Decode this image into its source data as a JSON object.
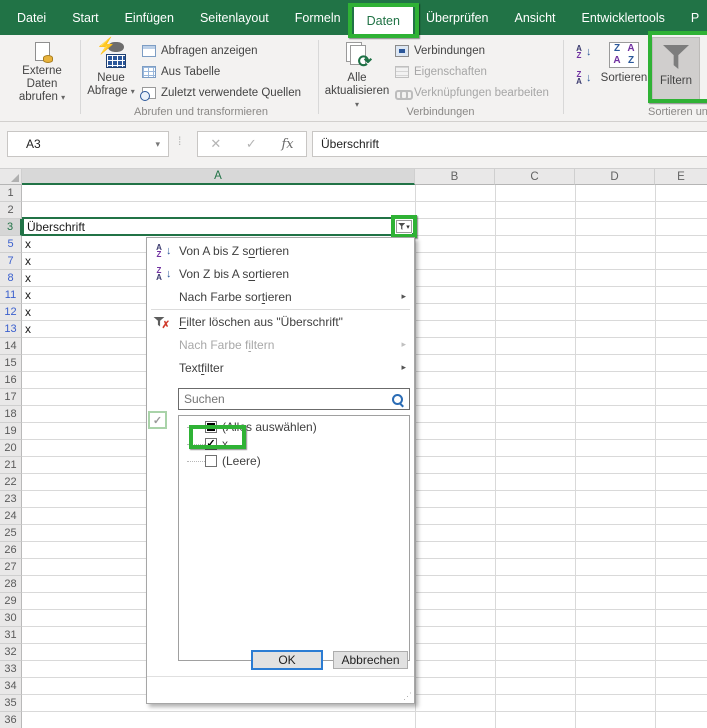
{
  "annotation_color": "#2fb235",
  "tabs": {
    "items": [
      {
        "label": "Datei",
        "cls": ""
      },
      {
        "label": "Start",
        "cls": ""
      },
      {
        "label": "Einfügen",
        "cls": ""
      },
      {
        "label": "Seitenlayout",
        "cls": ""
      },
      {
        "label": "Formeln",
        "cls": ""
      },
      {
        "label": "Daten",
        "cls": "active"
      },
      {
        "label": "Überprüfen",
        "cls": ""
      },
      {
        "label": "Ansicht",
        "cls": ""
      },
      {
        "label": "Entwicklertools",
        "cls": ""
      },
      {
        "label": "P",
        "cls": ""
      }
    ],
    "active": "Daten"
  },
  "ribbon": {
    "externe_daten": {
      "line1": "Externe Daten",
      "line2": "abrufen"
    },
    "neue_abfrage": {
      "line1": "Neue",
      "line2": "Abfrage"
    },
    "abfragen_anzeigen": "Abfragen anzeigen",
    "aus_tabelle": "Aus Tabelle",
    "zuletzt_quellen": "Zuletzt verwendete Quellen",
    "group1_label": "Abrufen und transformieren",
    "alle_aktualisieren": {
      "line1": "Alle",
      "line2": "aktualisieren"
    },
    "verbindungen_item": "Verbindungen",
    "eigenschaften_item": "Eigenschaften",
    "verknuepfungen_item": "Verknüpfungen bearbeiten",
    "group2_label": "Verbindungen",
    "sortieren": "Sortieren",
    "filtern": "Filtern",
    "group3_label": "Sortieren un"
  },
  "formula_bar": {
    "name_box": "A3",
    "cancel_glyph": "✕",
    "enter_glyph": "✓",
    "fx_label": "fx",
    "value": "Überschrift"
  },
  "grid": {
    "columns": [
      {
        "label": "A",
        "cls": "col-a"
      },
      {
        "label": "B",
        "cls": "col-b"
      },
      {
        "label": "C",
        "cls": "col-c"
      },
      {
        "label": "D",
        "cls": "col-d"
      },
      {
        "label": "E",
        "cls": "col-e"
      }
    ],
    "selected_column": "A",
    "active_cell": {
      "ref": "A3",
      "value": "Überschrift"
    },
    "rows": [
      {
        "num": "1",
        "value": "",
        "type": "normal"
      },
      {
        "num": "2",
        "value": "",
        "type": "normal"
      },
      {
        "num": "3",
        "value": "",
        "type": "active"
      },
      {
        "num": "5",
        "value": "x",
        "type": "filtered"
      },
      {
        "num": "7",
        "value": "x",
        "type": "filtered"
      },
      {
        "num": "8",
        "value": "x",
        "type": "filtered"
      },
      {
        "num": "11",
        "value": "x",
        "type": "filtered"
      },
      {
        "num": "12",
        "value": "x",
        "type": "filtered"
      },
      {
        "num": "13",
        "value": "x",
        "type": "filtered"
      },
      {
        "num": "14",
        "value": "",
        "type": "normal"
      },
      {
        "num": "15",
        "value": "",
        "type": "normal"
      },
      {
        "num": "16",
        "value": "",
        "type": "normal"
      },
      {
        "num": "17",
        "value": "",
        "type": "normal"
      },
      {
        "num": "18",
        "value": "",
        "type": "normal"
      },
      {
        "num": "19",
        "value": "",
        "type": "normal"
      },
      {
        "num": "20",
        "value": "",
        "type": "normal"
      },
      {
        "num": "21",
        "value": "",
        "type": "normal"
      },
      {
        "num": "22",
        "value": "",
        "type": "normal"
      },
      {
        "num": "23",
        "value": "",
        "type": "normal"
      },
      {
        "num": "24",
        "value": "",
        "type": "normal"
      },
      {
        "num": "25",
        "value": "",
        "type": "normal"
      },
      {
        "num": "26",
        "value": "",
        "type": "normal"
      },
      {
        "num": "27",
        "value": "",
        "type": "normal"
      },
      {
        "num": "28",
        "value": "",
        "type": "normal"
      },
      {
        "num": "29",
        "value": "",
        "type": "normal"
      },
      {
        "num": "30",
        "value": "",
        "type": "normal"
      },
      {
        "num": "31",
        "value": "",
        "type": "normal"
      },
      {
        "num": "32",
        "value": "",
        "type": "normal"
      },
      {
        "num": "33",
        "value": "",
        "type": "normal"
      },
      {
        "num": "34",
        "value": "",
        "type": "normal"
      },
      {
        "num": "35",
        "value": "",
        "type": "normal"
      },
      {
        "num": "36",
        "value": "",
        "type": "normal"
      }
    ]
  },
  "filter_menu": {
    "sort_az": {
      "pre": "Von A bis Z s",
      "key": "o",
      "post": "rtieren"
    },
    "sort_za": {
      "pre": "Von Z bis A s",
      "key": "o",
      "post": "rtieren"
    },
    "sort_color": {
      "pre": "Nach Farbe sor",
      "key": "t",
      "post": "ieren"
    },
    "clear_filter": {
      "pre": "",
      "key": "F",
      "post": "ilter löschen aus \"Überschrift\""
    },
    "filter_color": {
      "pre": "Nach Farbe f",
      "key": "i",
      "post": "ltern"
    },
    "text_filter": {
      "pre": "Text",
      "key": "f",
      "post": "ilter"
    },
    "search_placeholder": "Suchen",
    "list": {
      "select_all": "(Alles auswählen)",
      "item_x": "x",
      "item_empty": "(Leere)"
    },
    "ok_label": "OK",
    "cancel_label": "Abbrechen"
  },
  "glyphs": {
    "a": "A",
    "z": "Z",
    "down": "↓",
    "dropdown": "▾",
    "submenu": "▸",
    "check": "✓",
    "x_mark": "✗",
    "bolt": "⚡",
    "refresh": "⟳",
    "dots": "⁞",
    "grip": "⋰"
  }
}
